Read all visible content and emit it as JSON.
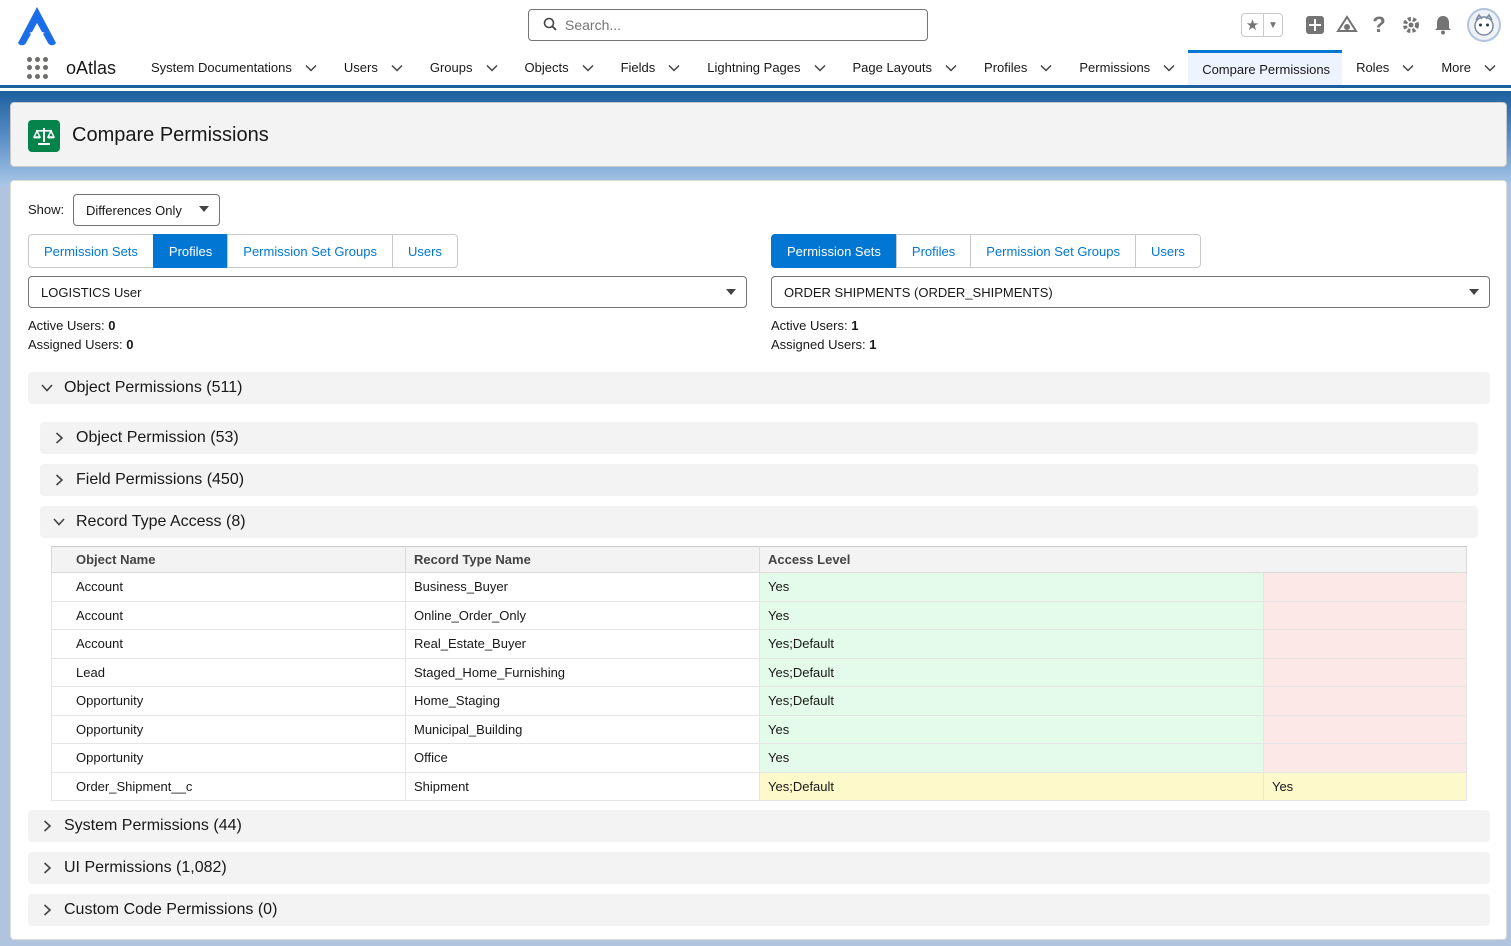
{
  "header": {
    "search_placeholder": "Search...",
    "icons": [
      "app-logo-icon",
      "search-icon",
      "favorites-star-icon",
      "add-icon",
      "trailhead-icon",
      "help-icon",
      "setup-gear-icon",
      "notifications-bell-icon",
      "user-avatar-icon"
    ]
  },
  "nav": {
    "app_name": "oAtlas",
    "items": [
      {
        "label": "System Documentations",
        "dropdown": true
      },
      {
        "label": "Users",
        "dropdown": true
      },
      {
        "label": "Groups",
        "dropdown": true
      },
      {
        "label": "Objects",
        "dropdown": true
      },
      {
        "label": "Fields",
        "dropdown": true
      },
      {
        "label": "Lightning Pages",
        "dropdown": true
      },
      {
        "label": "Page Layouts",
        "dropdown": true
      },
      {
        "label": "Profiles",
        "dropdown": true
      },
      {
        "label": "Permissions",
        "dropdown": true
      },
      {
        "label": "Compare Permissions",
        "dropdown": false,
        "active": true
      },
      {
        "label": "Roles",
        "dropdown": true
      },
      {
        "label": "More",
        "dropdown": true
      }
    ]
  },
  "page": {
    "title": "Compare Permissions"
  },
  "filters": {
    "show_label": "Show:",
    "show_value": "Differences Only"
  },
  "left": {
    "tabs": [
      "Permission Sets",
      "Profiles",
      "Permission Set Groups",
      "Users"
    ],
    "selected_tab": "Profiles",
    "selection": "LOGISTICS User",
    "active_users_label": "Active Users:",
    "active_users": "0",
    "assigned_users_label": "Assigned Users:",
    "assigned_users": "0"
  },
  "right": {
    "tabs": [
      "Permission Sets",
      "Profiles",
      "Permission Set Groups",
      "Users"
    ],
    "selected_tab": "Permission Sets",
    "selection": "ORDER SHIPMENTS (ORDER_SHIPMENTS)",
    "active_users_label": "Active Users:",
    "active_users": "1",
    "assigned_users_label": "Assigned Users:",
    "assigned_users": "1"
  },
  "sections": {
    "object_permissions": "Object Permissions (511)",
    "object_permission": "Object Permission (53)",
    "field_permissions": "Field Permissions (450)",
    "record_type_access": "Record Type Access (8)",
    "system_permissions": "System Permissions (44)",
    "ui_permissions": "UI Permissions (1,082)",
    "custom_code_permissions": "Custom Code Permissions (0)"
  },
  "record_type_table": {
    "columns": [
      "Object Name",
      "Record Type Name",
      "Access Level"
    ],
    "rows": [
      {
        "object": "Account",
        "record_type": "Business_Buyer",
        "left": "Yes",
        "right": "",
        "status": "diff"
      },
      {
        "object": "Account",
        "record_type": "Online_Order_Only",
        "left": "Yes",
        "right": "",
        "status": "diff"
      },
      {
        "object": "Account",
        "record_type": "Real_Estate_Buyer",
        "left": "Yes;Default",
        "right": "",
        "status": "diff"
      },
      {
        "object": "Lead",
        "record_type": "Staged_Home_Furnishing",
        "left": "Yes;Default",
        "right": "",
        "status": "diff"
      },
      {
        "object": "Opportunity",
        "record_type": "Home_Staging",
        "left": "Yes;Default",
        "right": "",
        "status": "diff"
      },
      {
        "object": "Opportunity",
        "record_type": "Municipal_Building",
        "left": "Yes",
        "right": "",
        "status": "diff"
      },
      {
        "object": "Opportunity",
        "record_type": "Office",
        "left": "Yes",
        "right": "",
        "status": "diff"
      },
      {
        "object": "Order_Shipment__c",
        "record_type": "Shipment",
        "left": "Yes;Default",
        "right": "Yes",
        "status": "partial"
      }
    ]
  },
  "colors": {
    "brand": "#0176d3",
    "nav_accent": "#1b5f9e",
    "page_icon": "#04844b",
    "added": "#e4fbe9",
    "removed": "#fde8e8",
    "changed": "#fdf9cb"
  }
}
